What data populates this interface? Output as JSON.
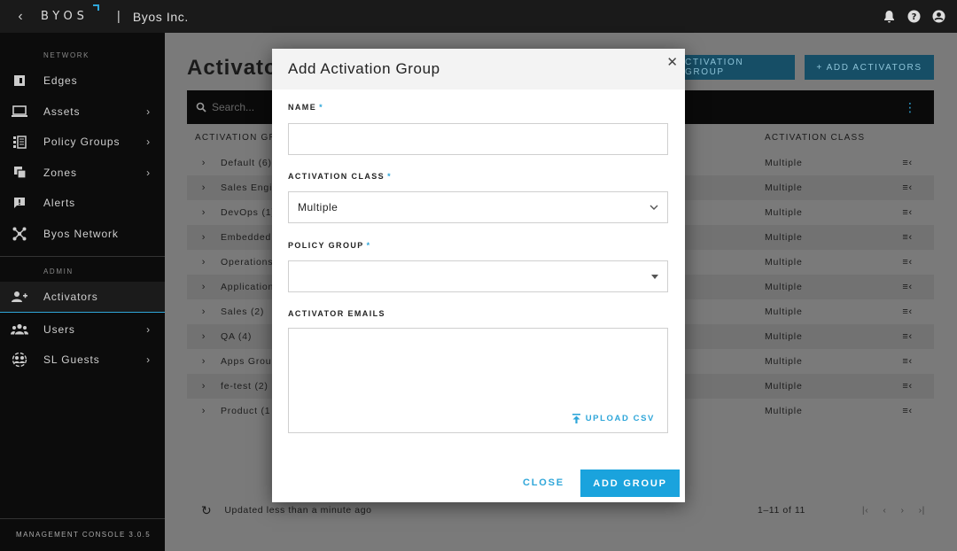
{
  "topbar": {
    "brand": "BYOS",
    "separator": "|",
    "org": "Byos Inc."
  },
  "sidebar": {
    "section_network": "NETWORK",
    "section_admin": "ADMIN",
    "network_items": [
      {
        "label": "Edges",
        "icon": "edges-icon",
        "has_children": false
      },
      {
        "label": "Assets",
        "icon": "monitor-icon",
        "has_children": true
      },
      {
        "label": "Policy Groups",
        "icon": "policy-list-icon",
        "has_children": true
      },
      {
        "label": "Zones",
        "icon": "zones-icon",
        "has_children": true
      },
      {
        "label": "Alerts",
        "icon": "alert-icon",
        "has_children": false
      },
      {
        "label": "Byos Network",
        "icon": "network-icon",
        "has_children": false
      }
    ],
    "admin_items": [
      {
        "label": "Activators",
        "icon": "add-user-icon",
        "has_children": false,
        "active": true
      },
      {
        "label": "Users",
        "icon": "users-icon",
        "has_children": true
      },
      {
        "label": "SL Guests",
        "icon": "guests-icon",
        "has_children": true
      }
    ],
    "version": "MANAGEMENT CONSOLE 3.0.5"
  },
  "main": {
    "title": "Activato",
    "btn_group": "CTIVATION GROUP",
    "btn_add": "+ ADD ACTIVATORS",
    "search_placeholder": "Search...",
    "col_group": "ACTIVATION GR",
    "col_class": "ACTIVATION CLASS",
    "rows": [
      {
        "name": "Default (6)",
        "class": "Multiple"
      },
      {
        "name": "Sales Engi",
        "class": "Multiple"
      },
      {
        "name": "DevOps (1)",
        "class": "Multiple"
      },
      {
        "name": "Embedded",
        "class": "Multiple"
      },
      {
        "name": "Operations",
        "class": "Multiple"
      },
      {
        "name": "Application",
        "class": "Multiple"
      },
      {
        "name": "Sales (2)",
        "class": "Multiple"
      },
      {
        "name": "QA (4)",
        "class": "Multiple"
      },
      {
        "name": "Apps Grou",
        "class": "Multiple"
      },
      {
        "name": "fe-test (2)",
        "class": "Multiple"
      },
      {
        "name": "Product (1",
        "class": "Multiple"
      }
    ],
    "updated": "Updated less than a minute ago",
    "pagination": "1–11 of 11"
  },
  "modal": {
    "title": "Add Activation Group",
    "name_label": "NAME",
    "name_value": "",
    "class_label": "ACTIVATION CLASS",
    "class_value": "Multiple",
    "policy_label": "POLICY GROUP",
    "policy_value": "",
    "emails_label": "ACTIVATOR EMAILS",
    "emails_value": "",
    "upload_label": "UPLOAD CSV",
    "close_label": "CLOSE",
    "add_label": "ADD GROUP",
    "required_mark": "*"
  },
  "colors": {
    "accent": "#1aa3dd",
    "sidebar_bg": "#0c0c0c",
    "dim_bg": "#7a7a7a"
  }
}
